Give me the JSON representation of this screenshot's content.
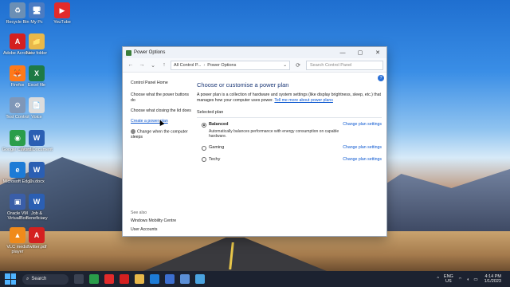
{
  "desktop": {
    "icons": [
      {
        "label": "Recycle Bin",
        "glyph": "♻",
        "color": "#6b8fb5"
      },
      {
        "label": "My Pc",
        "glyph": "🖥",
        "color": "#4b7bc2"
      },
      {
        "label": "YouTube",
        "glyph": "▶",
        "color": "#e22b2b"
      },
      {
        "label": "Adobe Acrobat",
        "glyph": "A",
        "color": "#d42020"
      },
      {
        "label": "New folder",
        "glyph": "📁",
        "color": "#e8b84a"
      },
      {
        "label": "Firefox",
        "glyph": "🦊",
        "color": "#ff7a1a"
      },
      {
        "label": "Excel file",
        "glyph": "X",
        "color": "#1e7a45"
      },
      {
        "label": "Test Control",
        "glyph": "⚙",
        "color": "#7f97b8"
      },
      {
        "label": "Voice",
        "glyph": "📄",
        "color": "#dcdcdc"
      },
      {
        "label": "Google Chrome",
        "glyph": "◉",
        "color": "#2a9d4a"
      },
      {
        "label": "Word Document",
        "glyph": "W",
        "color": "#2b5fb3"
      },
      {
        "label": "Microsoft Edge",
        "glyph": "e",
        "color": "#1d7bd6"
      },
      {
        "label": "Cv.docx",
        "glyph": "W",
        "color": "#2b5fb3"
      },
      {
        "label": "Oracle VM VirtualBox",
        "glyph": "▣",
        "color": "#3a5ea8"
      },
      {
        "label": "Job & Beneficiary",
        "glyph": "W",
        "color": "#2b5fb3"
      },
      {
        "label": "VLC media player",
        "glyph": "▲",
        "color": "#f08a1a"
      },
      {
        "label": "Twitter.pdf",
        "glyph": "A",
        "color": "#d42020"
      }
    ]
  },
  "window": {
    "title": "Power Options",
    "controls": {
      "minimize": "—",
      "maximize": "▢",
      "close": "✕"
    },
    "nav": {
      "back": "←",
      "forward": "→",
      "down": "⌄",
      "up": "↑",
      "crumb_root": "All Control P...",
      "crumb_sep": "›",
      "crumb_current": "Power Options",
      "dropdown": "⌄",
      "refresh": "⟳",
      "search_placeholder": "Search Control Panel"
    },
    "left_pane": {
      "home": "Control Panel Home",
      "links": [
        "Choose what the power buttons do",
        "Choose what closing the lid does",
        "Create a power plan",
        "Change when the computer sleeps"
      ],
      "see_also_header": "See also",
      "see_also": [
        "Windows Mobility Centre",
        "User Accounts"
      ]
    },
    "main": {
      "heading": "Choose or customise a power plan",
      "description": "A power plan is a collection of hardware and system settings (like display brightness, sleep, etc.) that manages how your computer uses power.",
      "description_link": "Tell me more about power plans",
      "selected_header": "Selected plan",
      "plans": [
        {
          "name": "Balanced",
          "selected": true,
          "subtitle": "Automatically balances performance with energy consumption on capable hardware.",
          "action": "Change plan settings"
        },
        {
          "name": "Gaming",
          "selected": false,
          "subtitle": "",
          "action": "Change plan settings"
        },
        {
          "name": "Techy",
          "selected": false,
          "subtitle": "",
          "action": "Change plan settings"
        }
      ],
      "help": "?"
    }
  },
  "taskbar": {
    "search_label": "Search",
    "search_icon": "⌕",
    "apps": [
      {
        "name": "task-view",
        "color": "#3b4252"
      },
      {
        "name": "chrome",
        "color": "#2a9d4a"
      },
      {
        "name": "youtube",
        "color": "#e22b2b"
      },
      {
        "name": "pdf",
        "color": "#d42020"
      },
      {
        "name": "file-explorer",
        "color": "#e8b84a"
      },
      {
        "name": "edge",
        "color": "#1d7bd6"
      },
      {
        "name": "store",
        "color": "#3c6fd0"
      },
      {
        "name": "settings",
        "color": "#5b8fd6"
      },
      {
        "name": "control-panel",
        "color": "#4aa3e0"
      }
    ],
    "tray": {
      "chevron": "^",
      "lang_top": "ENG",
      "lang_bottom": "US",
      "status_icons": "⌔ ◖ ▭",
      "time": "4:14 PM",
      "date": "1/1/2023"
    }
  }
}
